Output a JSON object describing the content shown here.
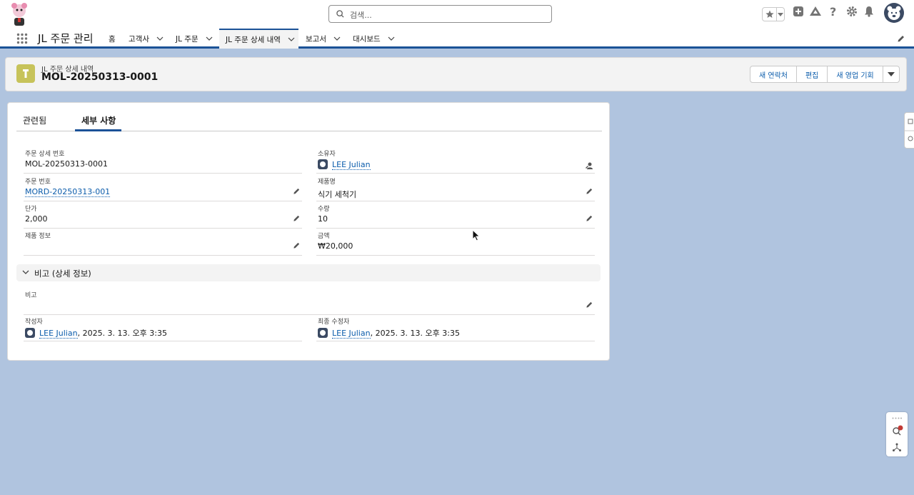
{
  "global_header": {
    "search_placeholder": "검색..."
  },
  "nav": {
    "app_name": "JL 주문 관리",
    "items": [
      {
        "label": "홈"
      },
      {
        "label": "고객사"
      },
      {
        "label": "JL 주문"
      },
      {
        "label": "JL 주문 상세 내역"
      },
      {
        "label": "보고서"
      },
      {
        "label": "대시보드"
      }
    ]
  },
  "record": {
    "object_label": "JL 주문 상세 내역",
    "title": "MOL-20250313-0001",
    "buttons": {
      "new_contact": "새 연락처",
      "edit": "편집",
      "new_opportunity": "새 영업 기회"
    }
  },
  "tabs": [
    {
      "label": "관련됨"
    },
    {
      "label": "세부 사항"
    }
  ],
  "fields": {
    "detail_no": {
      "label": "주문 상세 번호",
      "value": "MOL-20250313-0001"
    },
    "owner": {
      "label": "소유자",
      "value": "LEE Julian"
    },
    "order_no": {
      "label": "주문 번호",
      "value": "MORD-20250313-001"
    },
    "product_name": {
      "label": "제품명",
      "value": "식기 세척기"
    },
    "unit_price": {
      "label": "단가",
      "value": "2,000"
    },
    "quantity": {
      "label": "수량",
      "value": "10"
    },
    "product_info": {
      "label": "제품 정보",
      "value": ""
    },
    "amount": {
      "label": "금액",
      "value": "₩20,000"
    }
  },
  "section": {
    "title": "비고 (상세 정보)"
  },
  "notes": {
    "label": "비고",
    "value": ""
  },
  "audit": {
    "created": {
      "label": "작성자",
      "user": "LEE Julian",
      "date": ", 2025. 3. 13. 오후 3:35"
    },
    "modified": {
      "label": "최종 수정자",
      "user": "LEE Julian",
      "date": ", 2025. 3. 13. 오후 3:35"
    }
  }
}
